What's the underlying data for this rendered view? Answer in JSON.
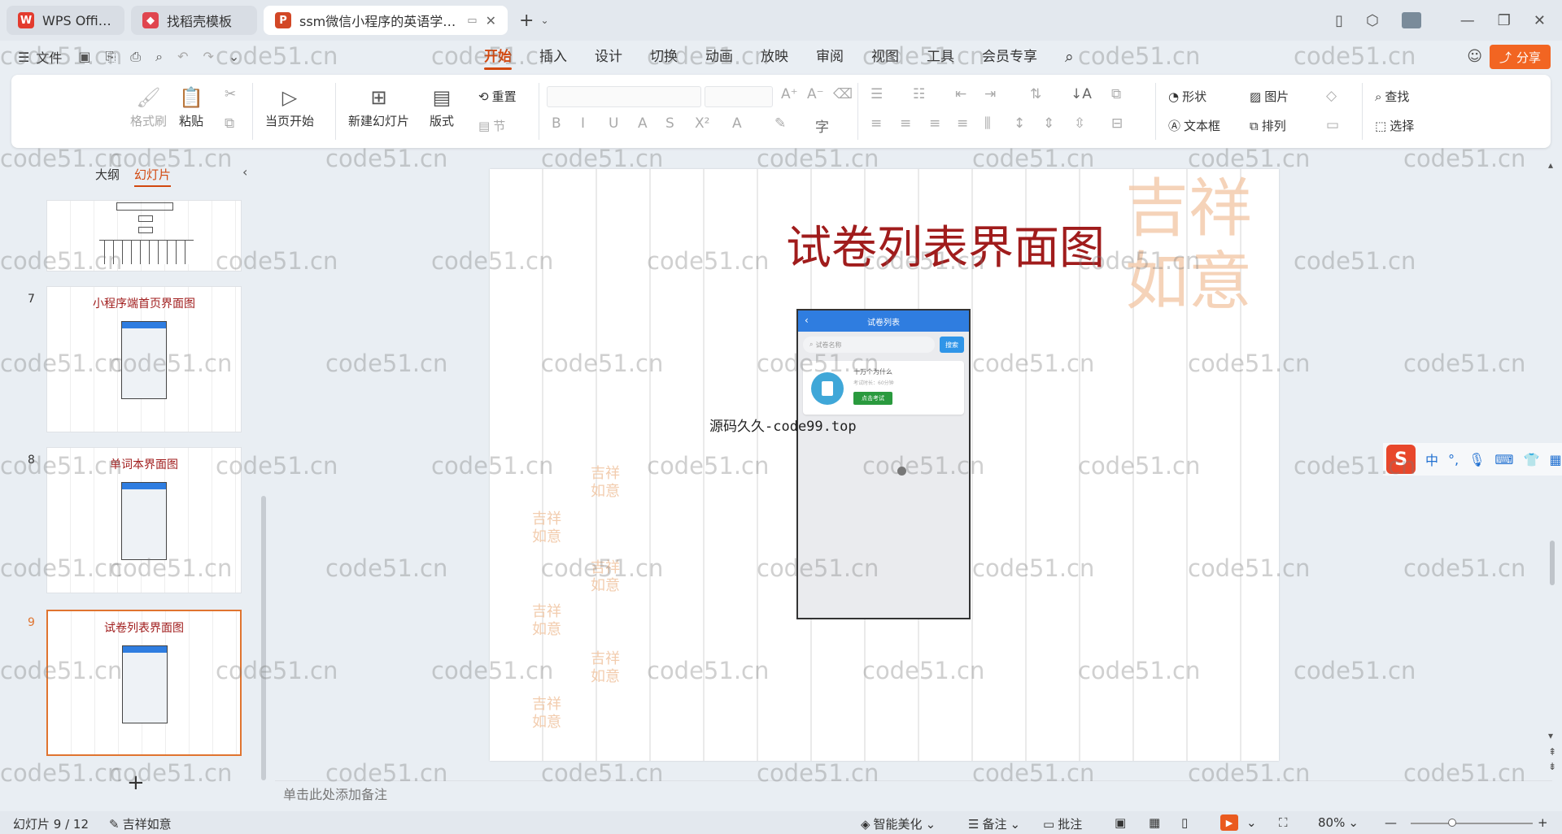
{
  "titlebar": {
    "tabs": [
      {
        "label": "WPS Office",
        "logo": "W",
        "color": "#e33b2e"
      },
      {
        "label": "找稻壳模板",
        "logo": "◆",
        "color": "#e0454f"
      },
      {
        "label": "ssm微信小程序的英语学习激励",
        "logo": "P",
        "color": "#d24726"
      }
    ],
    "new_tab": "+"
  },
  "menubar": {
    "file_label": "文件",
    "tabs": [
      "开始",
      "插入",
      "设计",
      "切换",
      "动画",
      "放映",
      "审阅",
      "视图",
      "工具",
      "会员专享"
    ],
    "active_tab": "开始",
    "share_label": "分享"
  },
  "ribbon": {
    "format_painter": "格式刷",
    "paste": "粘贴",
    "start_current": "当页开始",
    "new_slide": "新建幻灯片",
    "layout": "版式",
    "reset": "重置",
    "section": "节",
    "shape": "形状",
    "picture": "图片",
    "textbox": "文本框",
    "arrange": "排列",
    "find": "查找",
    "select": "选择"
  },
  "panel": {
    "tab_outline": "大纲",
    "tab_slides": "幻灯片",
    "slides": [
      {
        "num": "",
        "title": ""
      },
      {
        "num": "7",
        "title": "小程序端首页界面图"
      },
      {
        "num": "8",
        "title": "单词本界面图"
      },
      {
        "num": "9",
        "title": "试卷列表界面图"
      }
    ]
  },
  "slide": {
    "title": "试卷列表界面图",
    "overlay_text": "源码久久-code99.top",
    "phone": {
      "header": "试卷列表",
      "search_placeholder": "试卷名称",
      "search_button": "搜索",
      "exam_name": "十万个为什么",
      "exam_meta": "考试时长：60分钟",
      "start_button": "点击考试"
    }
  },
  "notes_placeholder": "单击此处添加备注",
  "status": {
    "slide_counter": "幻灯片 9 / 12",
    "theme": "吉祥如意",
    "beautify": "智能美化",
    "notes": "备注",
    "comment": "批注",
    "zoom": "80%"
  },
  "ime": {
    "lang": "中"
  },
  "watermark": "code51.cn"
}
